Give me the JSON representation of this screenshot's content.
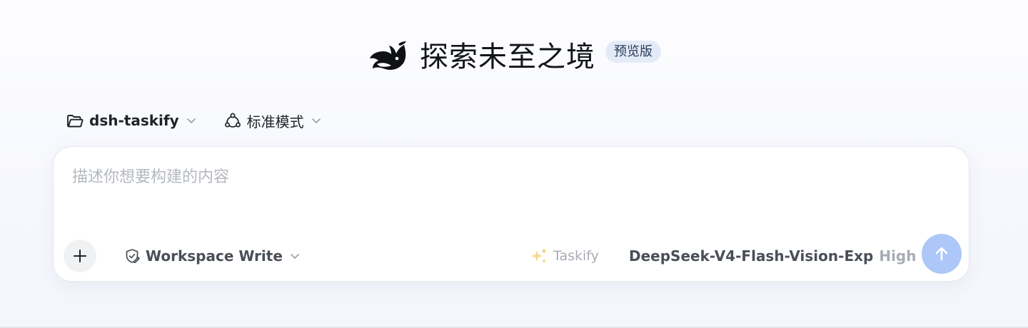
{
  "hero": {
    "title": "探索未至之境",
    "badge": "预览版",
    "logo_icon": "whale-logo-icon"
  },
  "selectors": {
    "project": {
      "label": "dsh-taskify",
      "icon": "folder-icon"
    },
    "mode": {
      "label": "标准模式",
      "icon": "workflow-icon"
    }
  },
  "composer": {
    "placeholder": "描述你想要构建的内容",
    "value": "",
    "attach_icon": "plus-icon",
    "permission": {
      "label": "Workspace Write",
      "icon": "shield-edit-icon"
    },
    "taskify": {
      "label": "Taskify",
      "icon": "sparkles-icon"
    },
    "model": {
      "name": "DeepSeek-V4-Flash-Vision-Exp",
      "effort": "High"
    },
    "send_icon": "arrow-up-icon",
    "send_enabled": false
  },
  "colors": {
    "send_button_disabled": "#adc7f8",
    "badge_background": "#e4ebf8",
    "placeholder_text": "#b4b8bf",
    "muted_text": "#a8acb3"
  }
}
